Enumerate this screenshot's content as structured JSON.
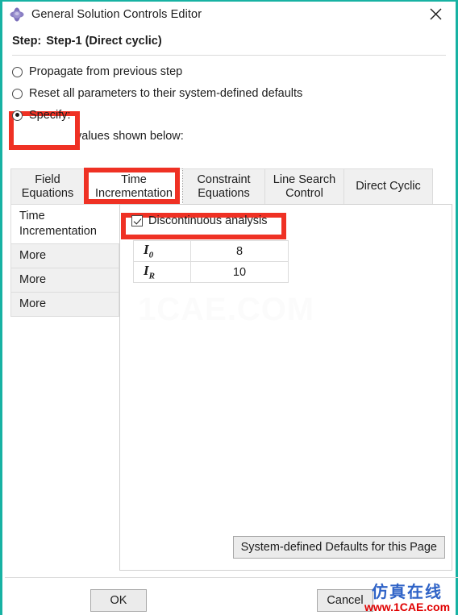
{
  "window": {
    "title": "General Solution Controls Editor",
    "app_icon": "abaqus-diamond-icon",
    "close_icon": "close-icon",
    "border_color": "#17b2a3"
  },
  "step": {
    "label": "Step:",
    "value": "Step-1 (Direct cyclic)"
  },
  "options": {
    "radios": [
      {
        "label": "Propagate from previous step",
        "checked": false
      },
      {
        "label": "Reset all parameters to their system-defined defaults",
        "checked": false
      },
      {
        "label": "Specify:",
        "checked": true
      }
    ],
    "note": "Propagated values shown below:"
  },
  "tabs": [
    {
      "label": "Field\nEquations",
      "active": false
    },
    {
      "label": "Time\nIncrementation",
      "active": true
    },
    {
      "label": "Constraint\nEquations",
      "active": false
    },
    {
      "label": "Line Search\nControl",
      "active": false
    },
    {
      "label": "Direct Cyclic",
      "active": false
    }
  ],
  "side_items": [
    {
      "label": "Time\nIncrementation",
      "active": true
    },
    {
      "label": "More",
      "active": false
    },
    {
      "label": "More",
      "active": false
    },
    {
      "label": "More",
      "active": false
    }
  ],
  "content": {
    "checkbox": {
      "label": "Discontinuous analysis",
      "checked": true
    },
    "table": {
      "rows": [
        {
          "symbol": "I",
          "subscript": "0",
          "value": "8"
        },
        {
          "symbol": "I",
          "subscript": "R",
          "value": "10"
        }
      ]
    },
    "watermark": "1CAE.COM",
    "defaults_button": "System-defined Defaults for this Page"
  },
  "footer": {
    "ok": "OK",
    "cancel": "Cancel"
  },
  "watermark_corner": {
    "cn": "仿真在线",
    "url": "www.1CAE.com",
    "cn_color": "#2f63c7",
    "url_color": "#e00000"
  },
  "annotations": {
    "color": "#ef3124",
    "boxes": [
      "specify-radio",
      "time-incrementation-tab",
      "discontinuous-analysis-checkbox"
    ]
  }
}
